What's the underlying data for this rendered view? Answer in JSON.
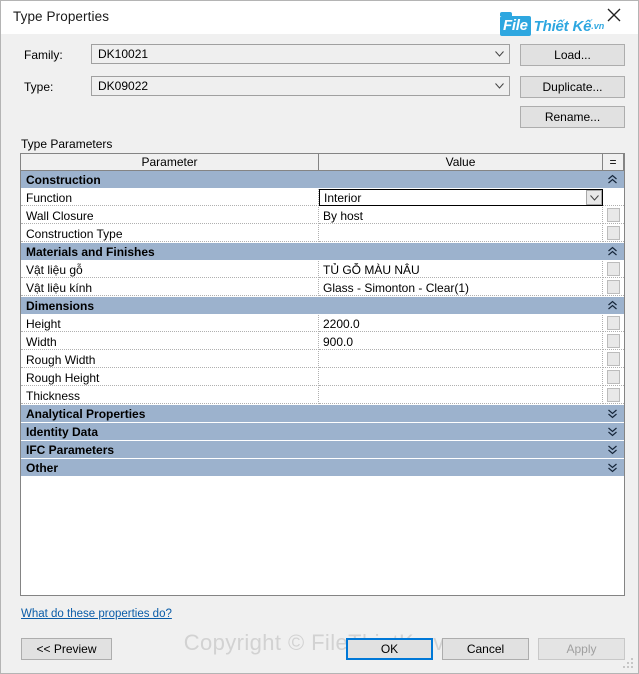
{
  "window": {
    "title": "Type Properties",
    "close_icon": "close-icon"
  },
  "brand": {
    "file": "File",
    "thietke": "Thiết Kế",
    "tld": ".vn"
  },
  "form": {
    "family_label": "Family:",
    "family_value": "DK10021",
    "type_label": "Type:",
    "type_value": "DK09022",
    "load_label": "Load...",
    "duplicate_label": "Duplicate...",
    "rename_label": "Rename..."
  },
  "table": {
    "caption": "Type Parameters",
    "headers": {
      "parameter": "Parameter",
      "value": "Value",
      "equals": "="
    },
    "sections": [
      {
        "title": "Construction",
        "collapsed": false,
        "rows": [
          {
            "parameter": "Function",
            "value": "Interior",
            "editing": true
          },
          {
            "parameter": "Wall Closure",
            "value": "By host",
            "editing": false
          },
          {
            "parameter": "Construction Type",
            "value": "",
            "editing": false
          }
        ]
      },
      {
        "title": "Materials and Finishes",
        "collapsed": false,
        "rows": [
          {
            "parameter": "Vật liệu gỗ",
            "value": "TỦ GỖ MÀU NÂU",
            "editing": false
          },
          {
            "parameter": "Vật liệu kính",
            "value": "Glass - Simonton - Clear(1)",
            "editing": false
          }
        ]
      },
      {
        "title": "Dimensions",
        "collapsed": false,
        "rows": [
          {
            "parameter": "Height",
            "value": "2200.0",
            "editing": false
          },
          {
            "parameter": "Width",
            "value": "900.0",
            "editing": false
          },
          {
            "parameter": "Rough Width",
            "value": "",
            "editing": false
          },
          {
            "parameter": "Rough Height",
            "value": "",
            "editing": false
          },
          {
            "parameter": "Thickness",
            "value": "",
            "editing": false
          }
        ]
      },
      {
        "title": "Analytical Properties",
        "collapsed": true,
        "rows": []
      },
      {
        "title": "Identity Data",
        "collapsed": true,
        "rows": []
      },
      {
        "title": "IFC Parameters",
        "collapsed": true,
        "rows": []
      },
      {
        "title": "Other",
        "collapsed": true,
        "rows": []
      }
    ]
  },
  "footer": {
    "help_link": "What do these properties do?",
    "preview_label": "<< Preview",
    "ok_label": "OK",
    "cancel_label": "Cancel",
    "apply_label": "Apply",
    "apply_enabled": false
  },
  "watermark": "Copyright © FileThietKe.vn",
  "colors": {
    "section_header": "#9cb2cd",
    "dialog_bg": "#f0f0f0",
    "accent_focus": "#0078d7",
    "link": "#0a5ca8",
    "brand": "#2ea7e0"
  }
}
